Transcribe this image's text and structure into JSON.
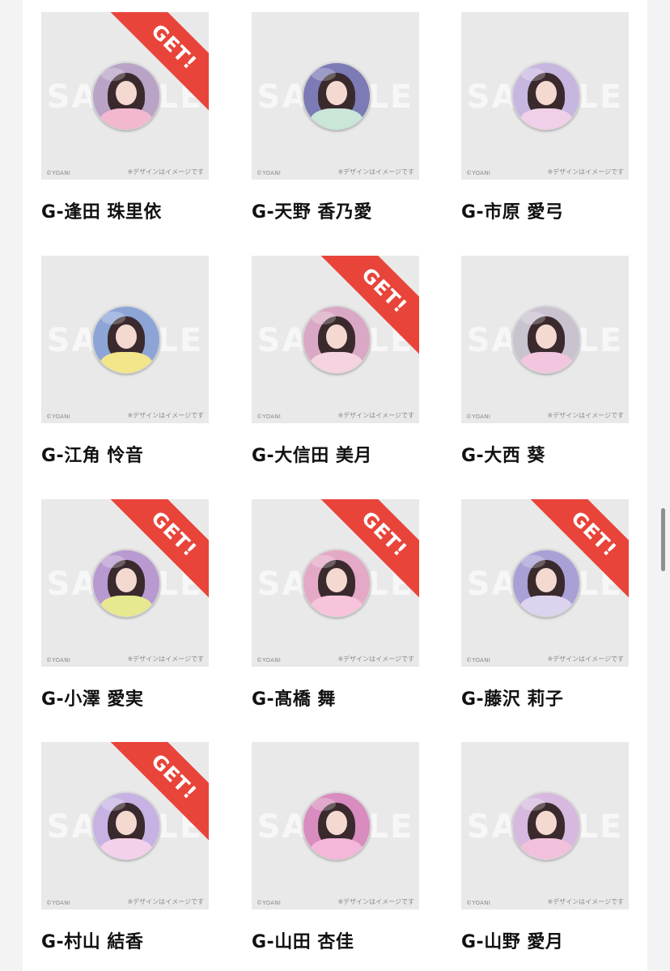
{
  "watermark": "SAMPLE",
  "copyright": "©YOANI",
  "note": "※デザインはイメージです",
  "get_label": "GET!",
  "colors": {
    "ribbon": "#e8443a",
    "thumb_bg": "#e9e9e9",
    "page_bg": "#f3f3f3"
  },
  "items": [
    {
      "name": "G-逢田 珠里依",
      "get": true,
      "bg": "#b9a3c7",
      "outfit": "#f2b8cf"
    },
    {
      "name": "G-天野 香乃愛",
      "get": false,
      "bg": "#7c7bb5",
      "outfit": "#c9e6d7"
    },
    {
      "name": "G-市原 愛弓",
      "get": false,
      "bg": "#c7b6e0",
      "outfit": "#f0d0e8"
    },
    {
      "name": "G-江角 怜音",
      "get": false,
      "bg": "#8da5d6",
      "outfit": "#f3e58a"
    },
    {
      "name": "G-大信田 美月",
      "get": true,
      "bg": "#d9a8c4",
      "outfit": "#f5d3e0"
    },
    {
      "name": "G-大西 葵",
      "get": false,
      "bg": "#c9c2cf",
      "outfit": "#f1c6de"
    },
    {
      "name": "G-小澤 愛実",
      "get": true,
      "bg": "#b99ad0",
      "outfit": "#e6e98f"
    },
    {
      "name": "G-髙橋 舞",
      "get": true,
      "bg": "#e4a9c6",
      "outfit": "#f7c4dc"
    },
    {
      "name": "G-藤沢 莉子",
      "get": true,
      "bg": "#a9a1d6",
      "outfit": "#dcd3ef"
    },
    {
      "name": "G-村山 結香",
      "get": true,
      "bg": "#c6b2e3",
      "outfit": "#f4d1ea"
    },
    {
      "name": "G-山田 杏佳",
      "get": false,
      "bg": "#d88cbf",
      "outfit": "#f4b6d9"
    },
    {
      "name": "G-山野 愛月",
      "get": false,
      "bg": "#d7b8de",
      "outfit": "#f1c1db"
    }
  ]
}
